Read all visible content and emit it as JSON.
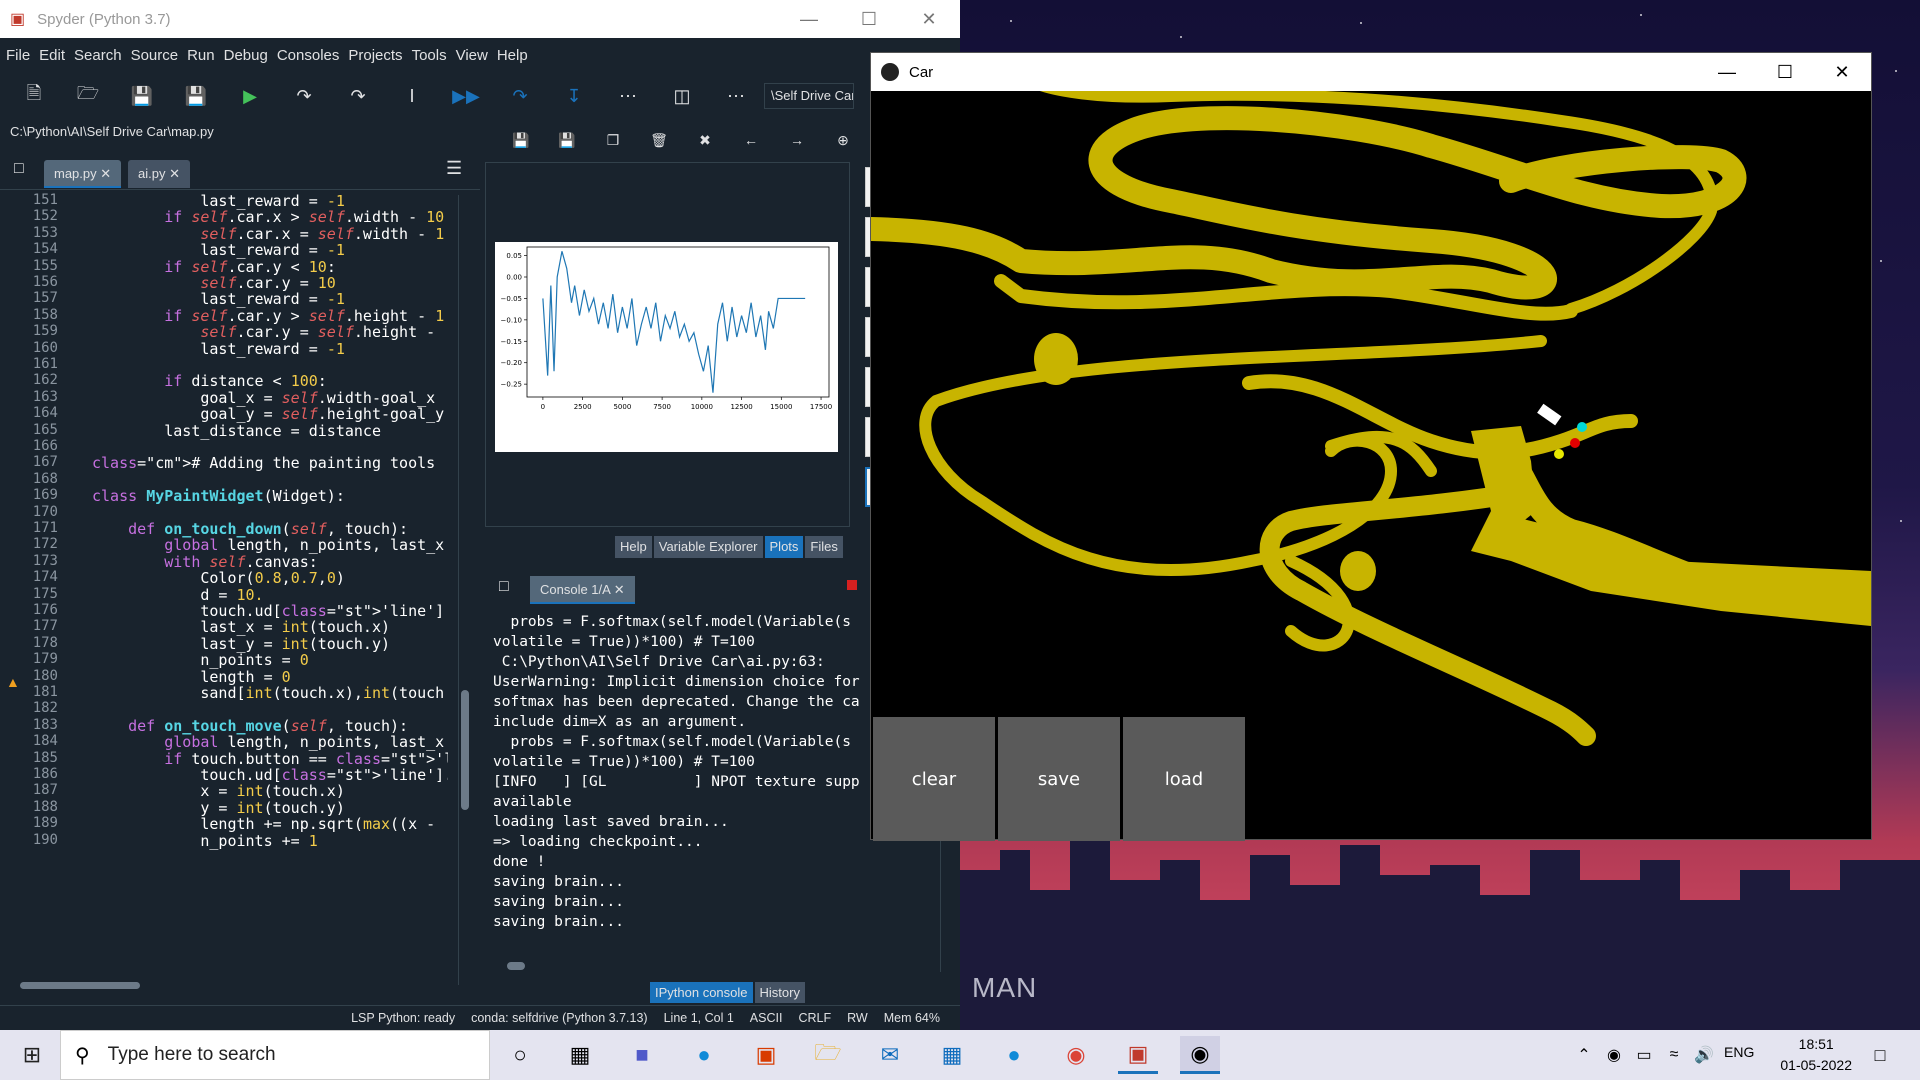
{
  "spyder": {
    "title": "Spyder (Python 3.7)",
    "menu": [
      "File",
      "Edit",
      "Search",
      "Source",
      "Run",
      "Debug",
      "Consoles",
      "Projects",
      "Tools",
      "View",
      "Help"
    ],
    "path_field": "\\Self Drive Car",
    "file_path": "C:\\Python\\AI\\Self Drive Car\\map.py",
    "tabs": [
      {
        "label": "map.py"
      },
      {
        "label": "ai.py"
      }
    ],
    "code_lines": [
      {
        "n": "151",
        "t": "            last_reward = -1"
      },
      {
        "n": "152",
        "t": "        if self.car.x > self.width - 10"
      },
      {
        "n": "153",
        "t": "            self.car.x = self.width - 1"
      },
      {
        "n": "154",
        "t": "            last_reward = -1"
      },
      {
        "n": "155",
        "t": "        if self.car.y < 10:"
      },
      {
        "n": "156",
        "t": "            self.car.y = 10"
      },
      {
        "n": "157",
        "t": "            last_reward = -1"
      },
      {
        "n": "158",
        "t": "        if self.car.y > self.height - 1"
      },
      {
        "n": "159",
        "t": "            self.car.y = self.height - "
      },
      {
        "n": "160",
        "t": "            last_reward = -1"
      },
      {
        "n": "161",
        "t": ""
      },
      {
        "n": "162",
        "t": "        if distance < 100:"
      },
      {
        "n": "163",
        "t": "            goal_x = self.width-goal_x"
      },
      {
        "n": "164",
        "t": "            goal_y = self.height-goal_y"
      },
      {
        "n": "165",
        "t": "        last_distance = distance"
      },
      {
        "n": "166",
        "t": ""
      },
      {
        "n": "167",
        "t": "# Adding the painting tools"
      },
      {
        "n": "168",
        "t": ""
      },
      {
        "n": "169",
        "t": "class MyPaintWidget(Widget):"
      },
      {
        "n": "170",
        "t": ""
      },
      {
        "n": "171",
        "t": "    def on_touch_down(self, touch):"
      },
      {
        "n": "172",
        "t": "        global length, n_points, last_x"
      },
      {
        "n": "173",
        "t": "        with self.canvas:"
      },
      {
        "n": "174",
        "t": "            Color(0.8,0.7,0)"
      },
      {
        "n": "175",
        "t": "            d = 10."
      },
      {
        "n": "176",
        "t": "            touch.ud['line'] = Line(poi"
      },
      {
        "n": "177",
        "t": "            last_x = int(touch.x)"
      },
      {
        "n": "178",
        "t": "            last_y = int(touch.y)"
      },
      {
        "n": "179",
        "t": "            n_points = 0"
      },
      {
        "n": "180",
        "t": "            length = 0"
      },
      {
        "n": "181",
        "t": "            sand[int(touch.x),int(touch"
      },
      {
        "n": "182",
        "t": ""
      },
      {
        "n": "183",
        "t": "    def on_touch_move(self, touch):"
      },
      {
        "n": "184",
        "t": "        global length, n_points, last_x"
      },
      {
        "n": "185",
        "t": "        if touch.button == 'left':"
      },
      {
        "n": "186",
        "t": "            touch.ud['line'].points +="
      },
      {
        "n": "187",
        "t": "            x = int(touch.x)"
      },
      {
        "n": "188",
        "t": "            y = int(touch.y)"
      },
      {
        "n": "189",
        "t": "            length += np.sqrt(max((x - "
      },
      {
        "n": "190",
        "t": "            n_points += 1"
      }
    ],
    "pane_tabs": [
      "Help",
      "Variable Explorer",
      "Plots",
      "Files"
    ],
    "console_tab": "Console 1/A",
    "console_lines": [
      "  probs = F.softmax(self.model(Variable(s",
      "volatile = True))*100) # T=100",
      " C:\\Python\\AI\\Self Drive Car\\ai.py:63:",
      "UserWarning: Implicit dimension choice for",
      "softmax has been deprecated. Change the ca",
      "include dim=X as an argument.",
      "  probs = F.softmax(self.model(Variable(s",
      "volatile = True))*100) # T=100",
      "[INFO   ] [GL          ] NPOT texture supp",
      "available",
      "loading last saved brain...",
      "=> loading checkpoint...",
      "done !",
      "saving brain...",
      "saving brain...",
      "saving brain..."
    ],
    "console_bottom_tabs": [
      "IPython console",
      "History"
    ],
    "status": [
      "LSP Python: ready",
      "conda: selfdrive (Python 3.7.13)",
      "Line 1, Col 1",
      "ASCII",
      "CRLF",
      "RW",
      "Mem 64%"
    ]
  },
  "chart_data": {
    "type": "line",
    "title": "",
    "xlabel": "",
    "ylabel": "",
    "xlim": [
      -1000,
      18000
    ],
    "ylim": [
      -0.28,
      0.07
    ],
    "xticks": [
      "0",
      "2500",
      "5000",
      "7500",
      "10000",
      "12500",
      "15000",
      "17500"
    ],
    "yticks": [
      "0.05",
      "0.00",
      "−0.05",
      "−0.10",
      "−0.15",
      "−0.20",
      "−0.25"
    ],
    "series": [
      {
        "color": "#1f77b4",
        "x": [
          0,
          300,
          500,
          700,
          900,
          1200,
          1500,
          1800,
          2000,
          2300,
          2600,
          2900,
          3200,
          3500,
          3800,
          4100,
          4400,
          4700,
          5000,
          5300,
          5600,
          5900,
          6200,
          6500,
          6800,
          7100,
          7400,
          7700,
          8000,
          8300,
          8600,
          8900,
          9200,
          9500,
          9800,
          10100,
          10400,
          10700,
          11000,
          11300,
          11600,
          11900,
          12200,
          12500,
          12800,
          13100,
          13400,
          13700,
          14000,
          14200,
          14500,
          14800,
          15000,
          15500,
          16000,
          16500
        ],
        "y": [
          -0.05,
          -0.23,
          -0.02,
          -0.22,
          0.0,
          0.06,
          0.02,
          -0.06,
          -0.02,
          -0.09,
          -0.03,
          -0.08,
          -0.05,
          -0.11,
          -0.06,
          -0.12,
          -0.04,
          -0.13,
          -0.07,
          -0.12,
          -0.05,
          -0.16,
          -0.11,
          -0.07,
          -0.12,
          -0.06,
          -0.15,
          -0.09,
          -0.12,
          -0.08,
          -0.14,
          -0.11,
          -0.15,
          -0.13,
          -0.18,
          -0.22,
          -0.16,
          -0.27,
          -0.11,
          -0.06,
          -0.15,
          -0.07,
          -0.14,
          -0.09,
          -0.13,
          -0.06,
          -0.14,
          -0.09,
          -0.17,
          -0.08,
          -0.12,
          -0.05,
          -0.05,
          -0.05,
          -0.05,
          -0.05
        ]
      }
    ]
  },
  "car_window": {
    "title": "Car",
    "buttons": [
      "clear",
      "save",
      "load"
    ]
  },
  "desktop": {
    "watermark": "MAN"
  },
  "taskbar": {
    "search_placeholder": "Type here to search",
    "lang": "ENG",
    "time": "18:51",
    "date": "01-05-2022"
  }
}
